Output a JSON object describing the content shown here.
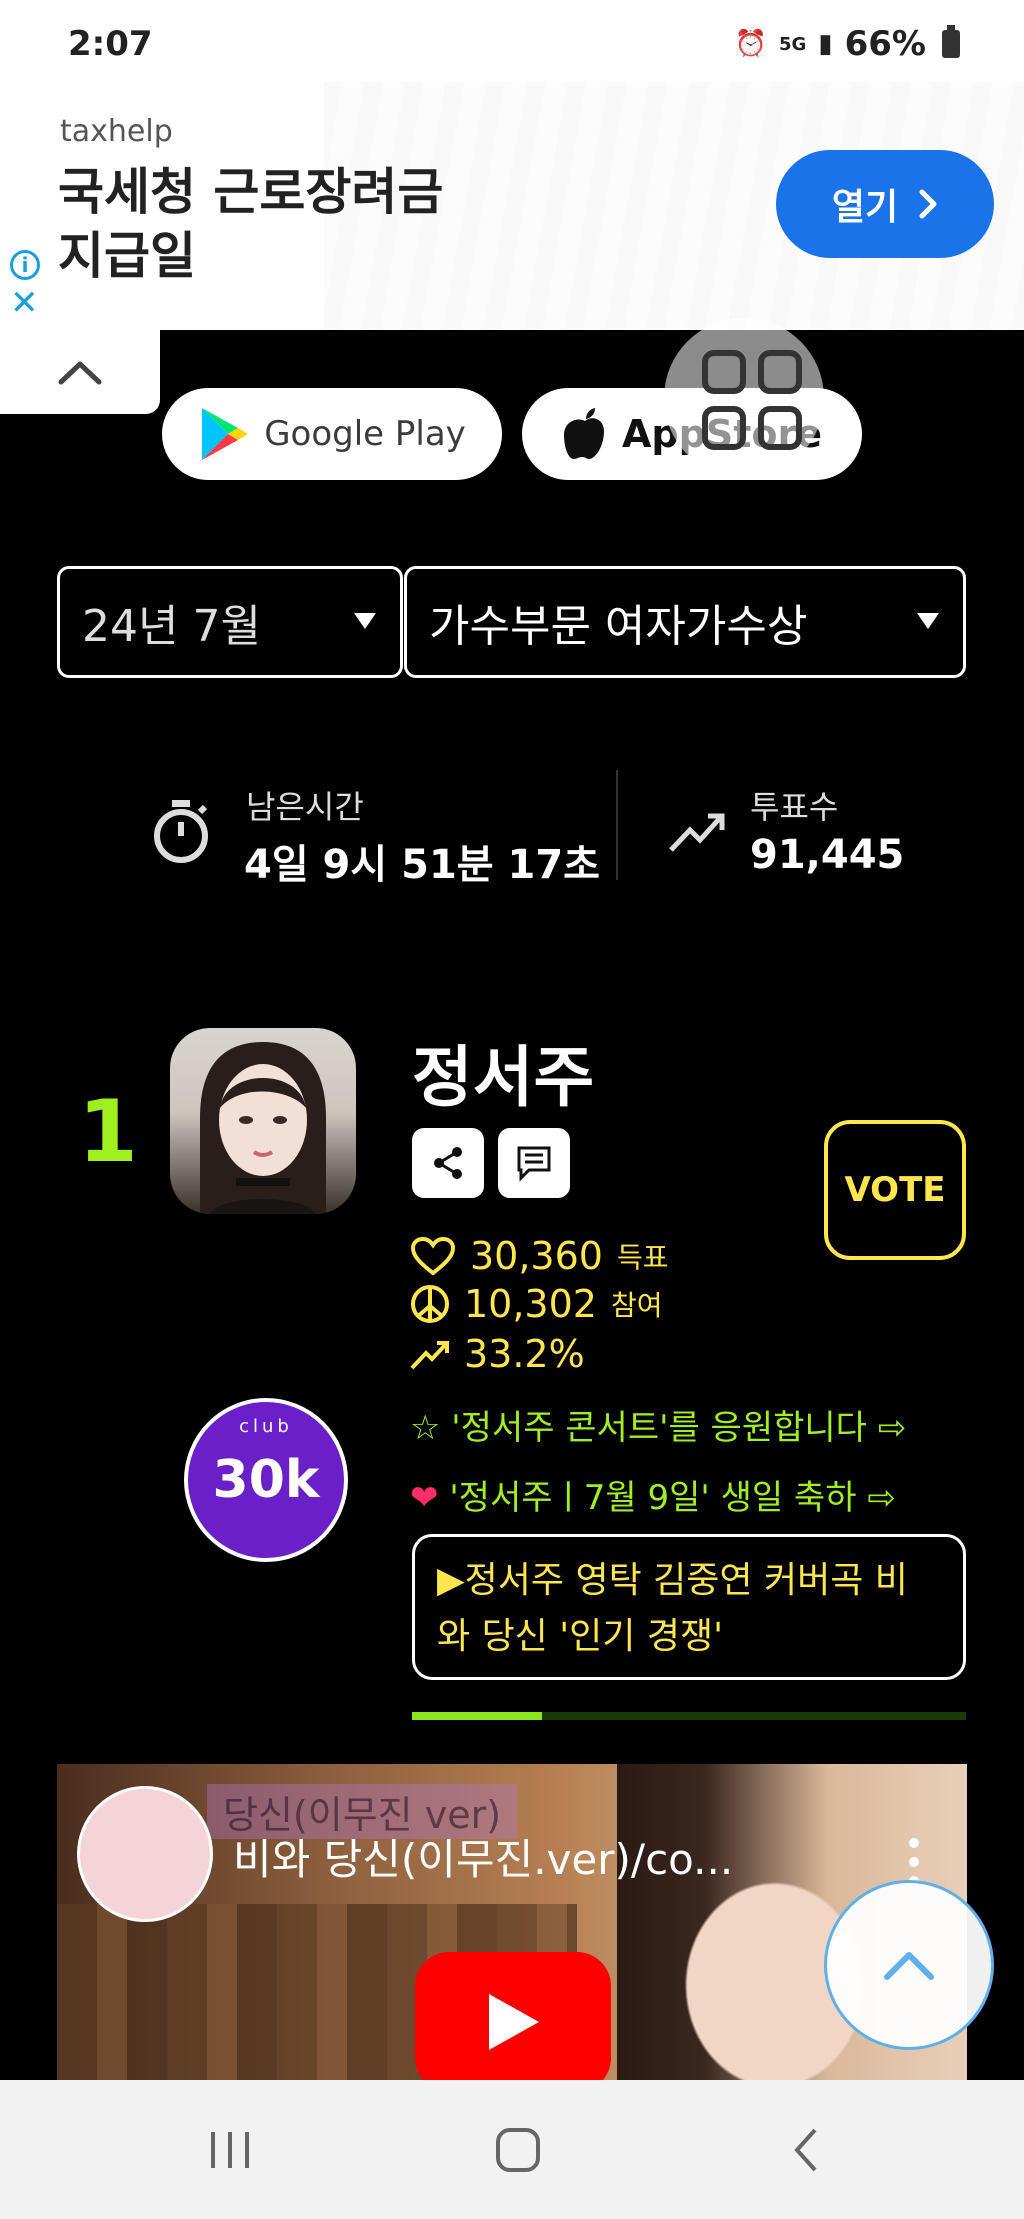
{
  "status_bar": {
    "time": "2:07",
    "network": "5G",
    "battery": "66%"
  },
  "ad": {
    "brand": "taxhelp",
    "headline_line1": "국세청 근로장려금",
    "headline_line2": "지급일",
    "cta_label": "열기",
    "cta_color": "#1a73e8"
  },
  "store_buttons": {
    "google_play": "Google Play",
    "app_store": "AppStore"
  },
  "filters": {
    "month": "24년 7월",
    "category": "가수부문 여자가수상"
  },
  "stats": {
    "remaining_label": "남은시간",
    "remaining_value": "4일 9시 51분 17초",
    "votes_label": "투표수",
    "votes_value": "91,445"
  },
  "candidate": {
    "rank": "1",
    "name": "정서주",
    "vote_label": "VOTE",
    "votes_count": "30,360",
    "votes_unit": "득표",
    "participants_count": "10,302",
    "participants_unit": "참여",
    "share_percent": "33.2%",
    "club_top": "club",
    "club_badge": "30k",
    "cheer1": "☆ '정서주 콘서트'를 응원합니다 ⇨",
    "cheer2": "'정서주ㅣ7월 9일' 생일 축하 ⇨",
    "news": "▶정서주 영탁 김중연 커버곡 비와 당신 '인기 경쟁'",
    "progress": 0.235,
    "accent_color": "#a0f020",
    "highlight_color": "#ffe64d"
  },
  "video": {
    "title": "비와 당신(이무진.ver)/co...",
    "overlay_text": "당신(이무진 ver)"
  }
}
